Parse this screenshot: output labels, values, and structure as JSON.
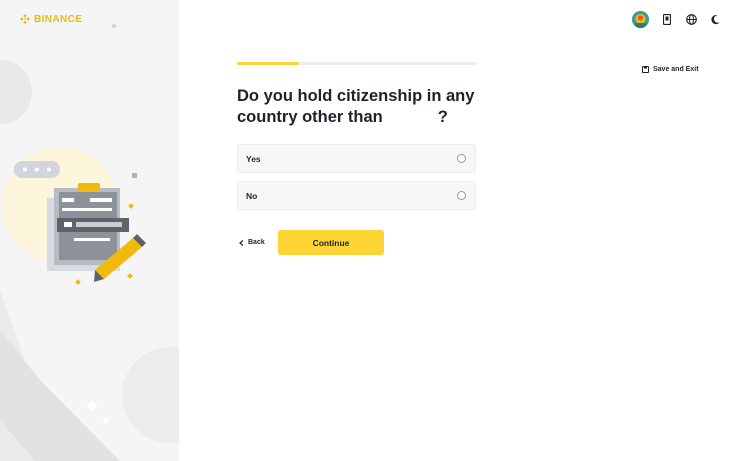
{
  "brand": {
    "name": "BINANCE",
    "color": "#f0b90b"
  },
  "topbar": {
    "avatar_icon": "user-avatar-icon",
    "icons": [
      "qr-code-icon",
      "globe-icon",
      "moon-icon"
    ]
  },
  "save_exit": {
    "label": "Save and Exit",
    "icon": "save-icon"
  },
  "progress": {
    "value": 0.26
  },
  "question": {
    "line1": "Do you hold citizenship in any",
    "line2_start": "country other than",
    "line2_end": "?"
  },
  "options": [
    {
      "label": "Yes",
      "selected": false
    },
    {
      "label": "No",
      "selected": false
    }
  ],
  "actions": {
    "back_label": "Back",
    "continue_label": "Continue"
  },
  "colors": {
    "accent": "#fcd535",
    "text": "#1e2329",
    "panel": "#f5f5f5"
  }
}
